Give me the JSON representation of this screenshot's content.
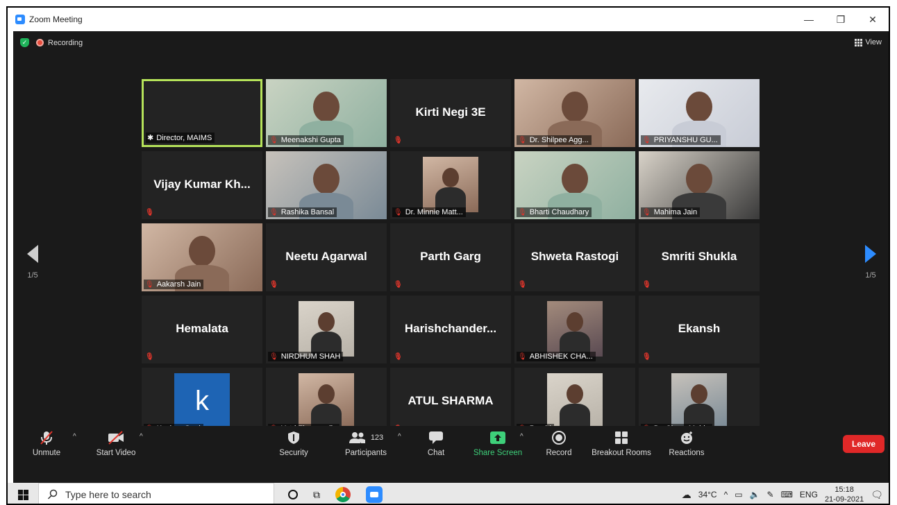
{
  "window": {
    "title": "Zoom Meeting",
    "minimize": "—",
    "restore": "❐",
    "close": "✕"
  },
  "status": {
    "recording": "Recording",
    "view": "View"
  },
  "pager": {
    "left": "1/5",
    "right": "1/5"
  },
  "tiles": [
    {
      "name": "Director, MAIMS",
      "type": "blank",
      "active": true,
      "pin": true
    },
    {
      "name": "Meenakshi Gupta",
      "type": "video"
    },
    {
      "name": "Kirti Negi 3E",
      "type": "name"
    },
    {
      "name": "Dr. Shilpee Agg...",
      "type": "video"
    },
    {
      "name": "PRIYANSHU GU...",
      "type": "video"
    },
    {
      "name": "Vijay Kumar Kh...",
      "type": "name"
    },
    {
      "name": "Rashika Bansal",
      "type": "video"
    },
    {
      "name": "Dr. Minnie Matt...",
      "type": "photo"
    },
    {
      "name": "Bharti Chaudhary",
      "type": "video"
    },
    {
      "name": "Mahima Jain",
      "type": "video"
    },
    {
      "name": "Aakarsh Jain",
      "type": "video"
    },
    {
      "name": "Neetu  Agarwal",
      "type": "name"
    },
    {
      "name": "Parth Garg",
      "type": "name"
    },
    {
      "name": "Shweta Rastogi",
      "type": "name"
    },
    {
      "name": "Smriti Shukla",
      "type": "name"
    },
    {
      "name": "Hemalata",
      "type": "name"
    },
    {
      "name": "NIRDHUM SHAH",
      "type": "photo"
    },
    {
      "name": "Harishchander...",
      "type": "name"
    },
    {
      "name": "ABHISHEK CHA...",
      "type": "photo"
    },
    {
      "name": "Ekansh",
      "type": "name"
    },
    {
      "name": "Keshav Goel",
      "type": "avatar",
      "letter": "k"
    },
    {
      "name": "Yatri Zinzuwadia",
      "type": "photo"
    },
    {
      "name": "ATUL SHARMA",
      "type": "name"
    },
    {
      "name": "Prachi",
      "type": "photo"
    },
    {
      "name": "Dr. Charu Mohla",
      "type": "photo"
    }
  ],
  "toolbar": {
    "unmute": "Unmute",
    "start_video": "Start Video",
    "security": "Security",
    "participants": "Participants",
    "participant_count": "123",
    "chat": "Chat",
    "share_screen": "Share Screen",
    "record": "Record",
    "breakout": "Breakout Rooms",
    "reactions": "Reactions",
    "leave": "Leave"
  },
  "taskbar": {
    "search_placeholder": "Type here to search",
    "temperature": "34°C",
    "lang": "ENG",
    "time": "15:18",
    "date": "21-09-2021"
  }
}
